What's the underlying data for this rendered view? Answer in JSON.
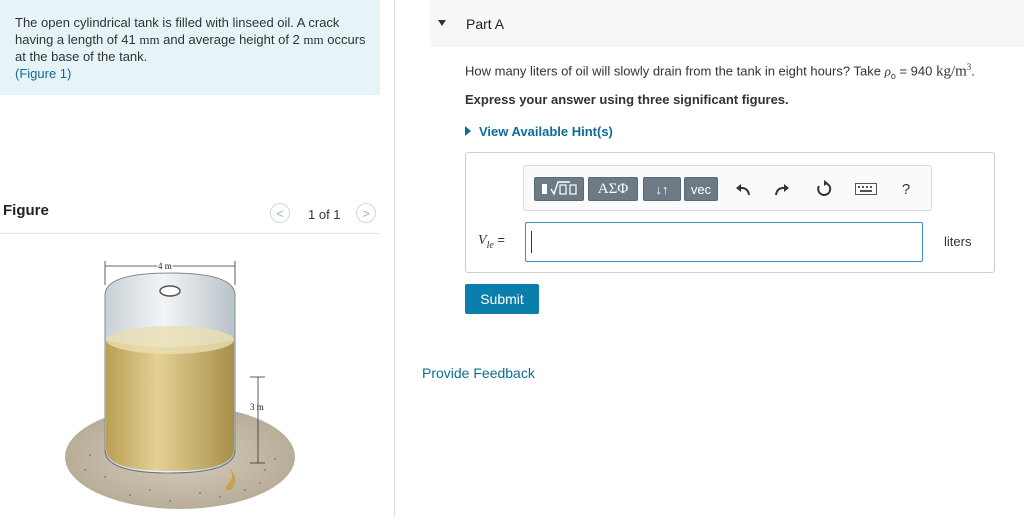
{
  "problem": {
    "text_part1": "The open cylindrical tank is filled with linseed oil. A crack having a length of 41 ",
    "length_unit": "mm",
    "text_part2": " and average height of 2 ",
    "height_unit": "mm",
    "text_part3": " occurs at the base of the tank.",
    "figure_link": "(Figure 1)"
  },
  "figure": {
    "title": "Figure",
    "pager_prev_icon": "chevron-left-icon",
    "pager_next_icon": "chevron-right-icon",
    "prev_glyph": "<",
    "next_glyph": ">",
    "pager_text": "1 of 1",
    "width_label": "4 m",
    "height_label": "3 m"
  },
  "part": {
    "title": "Part A",
    "toggle_icon": "caret-down-icon"
  },
  "question": {
    "text": "How many liters of oil will slowly drain from the tank in eight hours? Take ",
    "rho_symbol": "ρ",
    "rho_sub": "o",
    "equals_value": " = 940 ",
    "unit": "kg/m",
    "unit_exp": "3",
    "end": ".",
    "instruction": "Express your answer using three significant figures."
  },
  "hints": {
    "label": "View Available Hint(s)"
  },
  "toolbar": {
    "templates_icon": "math-templates-icon",
    "greek": "ΑΣΦ",
    "arrows": "↓↑",
    "vec": "vec",
    "undo_icon": "undo-icon",
    "redo_icon": "redo-icon",
    "reset_icon": "reset-icon",
    "keyboard_icon": "keyboard-icon",
    "help": "?"
  },
  "answer": {
    "variable": "V",
    "variable_sub": "le",
    "equals": " =",
    "value": "",
    "unit": "liters"
  },
  "actions": {
    "submit": "Submit",
    "feedback": "Provide Feedback"
  },
  "colors": {
    "problem_bg": "#e6f4f7",
    "link": "#0e6b96",
    "submit_bg": "#0b7fab",
    "toolbar_btn": "#6c7a85",
    "oil": "#d9c27a"
  }
}
